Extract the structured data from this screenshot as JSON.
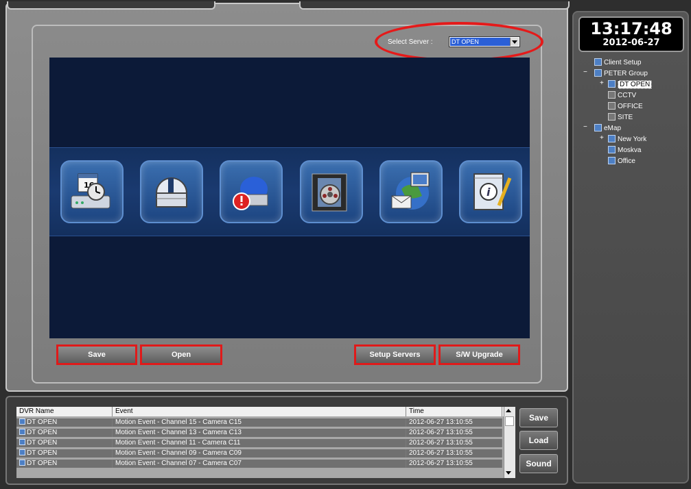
{
  "server_selector": {
    "label": "Select Server :",
    "selected": "DT OPEN"
  },
  "toolbar_icons": [
    {
      "name": "schedule-dvr-icon"
    },
    {
      "name": "observatory-icon"
    },
    {
      "name": "alarm-siren-icon"
    },
    {
      "name": "film-reel-icon"
    },
    {
      "name": "globe-mail-icon"
    },
    {
      "name": "info-notebook-icon"
    }
  ],
  "actions": {
    "save": "Save",
    "open": "Open",
    "setup_servers": "Setup Servers",
    "sw_upgrade": "S/W Upgrade"
  },
  "clock": {
    "time": "13:17:48",
    "date": "2012-06-27"
  },
  "tree": [
    {
      "label": "Client Setup",
      "icon": "client-setup-icon"
    },
    {
      "label": "PETER Group",
      "icon": "group-icon"
    },
    {
      "label": "DT OPEN",
      "icon": "server-icon",
      "selected": true
    },
    {
      "label": "CCTV",
      "icon": "server-icon"
    },
    {
      "label": "OFFICE",
      "icon": "server-icon"
    },
    {
      "label": "SITE",
      "icon": "server-icon"
    },
    {
      "label": "eMap",
      "icon": "emap-icon"
    },
    {
      "label": "New York",
      "icon": "map-location-icon"
    },
    {
      "label": "Moskva",
      "icon": "map-location-icon"
    },
    {
      "label": "Office",
      "icon": "map-location-icon"
    }
  ],
  "log": {
    "columns": [
      "DVR Name",
      "Event",
      "Time"
    ],
    "rows": [
      {
        "dvr": "DT OPEN",
        "event": "Motion Event  -  Channel 15  -  Camera C15",
        "time": "2012-06-27 13:10:55"
      },
      {
        "dvr": "DT OPEN",
        "event": "Motion Event  -  Channel 13  -  Camera C13",
        "time": "2012-06-27 13:10:55"
      },
      {
        "dvr": "DT OPEN",
        "event": "Motion Event  -  Channel 11  -  Camera C11",
        "time": "2012-06-27 13:10:55"
      },
      {
        "dvr": "DT OPEN",
        "event": "Motion Event  -  Channel 09  -  Camera C09",
        "time": "2012-06-27 13:10:55"
      },
      {
        "dvr": "DT OPEN",
        "event": "Motion Event  -  Channel 07  -  Camera C07",
        "time": "2012-06-27 13:10:55"
      }
    ]
  },
  "log_buttons": {
    "save": "Save",
    "load": "Load",
    "sound": "Sound"
  },
  "colors": {
    "highlight_red": "#e01a1a",
    "dark_area": "#0c1a38",
    "selection_blue": "#2b5fd6"
  }
}
